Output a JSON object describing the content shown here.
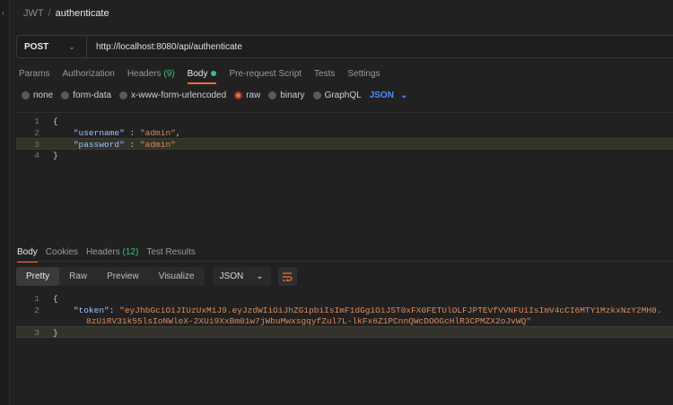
{
  "breadcrumb": {
    "collection": "JWT",
    "separator": "/",
    "request": "authenticate"
  },
  "request": {
    "method": "POST",
    "url": "http://localhost:8080/api/authenticate"
  },
  "request_tabs": [
    {
      "label": "Params"
    },
    {
      "label": "Authorization"
    },
    {
      "label": "Headers",
      "count": "(9)"
    },
    {
      "label": "Body",
      "active": true
    },
    {
      "label": "Pre-request Script"
    },
    {
      "label": "Tests"
    },
    {
      "label": "Settings"
    }
  ],
  "body_types": {
    "options": [
      "none",
      "form-data",
      "x-www-form-urlencoded",
      "raw",
      "binary",
      "GraphQL"
    ],
    "selected": "raw",
    "format": "JSON"
  },
  "request_body": {
    "line_numbers": [
      "1",
      "2",
      "3",
      "4"
    ],
    "open_brace": "{",
    "username_key": "\"username\"",
    "username_value": "\"admin\"",
    "password_key": "\"password\"",
    "password_value": "\"admin\"",
    "close_brace": "}"
  },
  "response_tabs": [
    {
      "label": "Body",
      "active": true
    },
    {
      "label": "Cookies"
    },
    {
      "label": "Headers",
      "count": "(12)"
    },
    {
      "label": "Test Results"
    }
  ],
  "response_view": {
    "modes": [
      "Pretty",
      "Raw",
      "Preview",
      "Visualize"
    ],
    "active": "Pretty",
    "format": "JSON"
  },
  "response_body": {
    "line_numbers": [
      "1",
      "2",
      "3"
    ],
    "open_brace": "{",
    "token_key": "\"token\"",
    "token_value_line1": "\"eyJhbGciOiJIUzUxMiJ9.eyJzdWIiOiJhZG1pbiIsImF1dGgiOiJST0xFX0FETUlOLFJPTEVfVVNFUiIsImV4cCI6MTY1MzkxNzY2MH0.",
    "token_value_line2": "8zUiRV31k55lsIoNWleX-2XUi9XxBm01w7jWbuMwxsgqyfZul7L-lkFx6Z1PCnnQWcDOOGcHlR3CPMZX2oJvWQ\"",
    "close_brace": "}"
  },
  "colors": {
    "accent": "#ff6c37",
    "count": "#3ec27a",
    "json_link": "#4a8cff"
  }
}
